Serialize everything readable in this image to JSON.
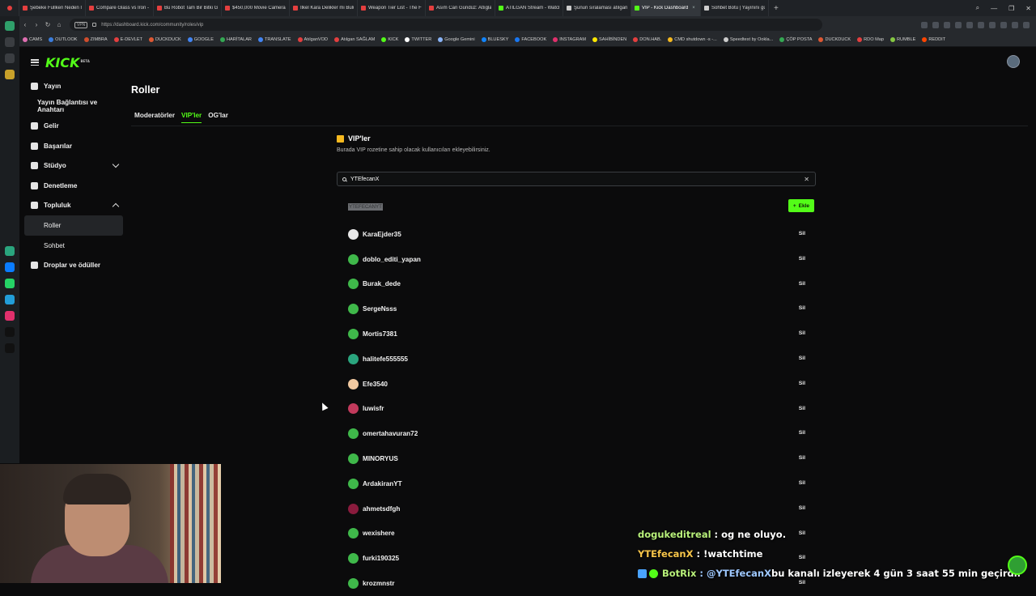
{
  "browser": {
    "tabs": [
      {
        "label": "Şebeke Fullken Neden İmi",
        "color": "#e43f3f",
        "active": false
      },
      {
        "label": "Compare Glass vs Iron - Y",
        "color": "#e43f3f",
        "active": false
      },
      {
        "label": "Bu Robot Tam Bir Bitki Gi",
        "color": "#e43f3f",
        "active": false
      },
      {
        "label": "$450,000 Movie Camera",
        "color": "#e43f3f",
        "active": false
      },
      {
        "label": "İlkel Kara Delikler mi Bulu",
        "color": "#e43f3f",
        "active": false
      },
      {
        "label": "Weapon Tier List - The Fo",
        "color": "#e43f3f",
        "active": false
      },
      {
        "label": "Asım Can Gündüz: Atlıgla",
        "color": "#e43f3f",
        "active": false
      },
      {
        "label": "ATILGAN Stream - Watch",
        "color": "#53fc18",
        "active": false
      },
      {
        "label": "Şunun sıralaması atılgan",
        "color": "#cccccc",
        "active": false
      },
      {
        "label": "VIP - Kick Dashboard",
        "color": "#53fc18",
        "active": true
      },
      {
        "label": "Sohbet Botu | Yayınını gü",
        "color": "#cccccc",
        "active": false
      }
    ],
    "url": "https://dashboard.kick.com/community/roles/vip",
    "vpn_label": "VPN",
    "bookmarks": [
      {
        "label": "CAMS",
        "color": "#e06fb1"
      },
      {
        "label": "OUTLOOK",
        "color": "#3b7ddd"
      },
      {
        "label": "ZIMBRA",
        "color": "#d04d2d"
      },
      {
        "label": "E-DEVLET",
        "color": "#e43f3f"
      },
      {
        "label": "DUCKDUCK",
        "color": "#de5833"
      },
      {
        "label": "GOOGLE",
        "color": "#4285f4"
      },
      {
        "label": "HARİTALAR",
        "color": "#34a853"
      },
      {
        "label": "TRANSLATE",
        "color": "#4285f4"
      },
      {
        "label": "AtılganVOD",
        "color": "#e43f3f"
      },
      {
        "label": "Atılgan SAĞLAM",
        "color": "#e43f3f"
      },
      {
        "label": "KICK",
        "color": "#53fc18"
      },
      {
        "label": "TWITTER",
        "color": "#ffffff"
      },
      {
        "label": "Google Gemini",
        "color": "#8ab4f8"
      },
      {
        "label": "BLUESKY",
        "color": "#1185fe"
      },
      {
        "label": "FACEBOOK",
        "color": "#1877f2"
      },
      {
        "label": "INSTAGRAM",
        "color": "#e1306c"
      },
      {
        "label": "SAHİBİNDEN",
        "color": "#ffe800"
      },
      {
        "label": "DON.HAB.",
        "color": "#e43f3f"
      },
      {
        "label": "CMD shutdown -s -...",
        "color": "#f6b91f"
      },
      {
        "label": "Speedtest by Ookla...",
        "color": "#cccccc"
      },
      {
        "label": "ÇÖP POSTA",
        "color": "#34a853"
      },
      {
        "label": "DUCKDUCK",
        "color": "#de5833"
      },
      {
        "label": "RDO Map",
        "color": "#e43f3f"
      },
      {
        "label": "RUMBLE",
        "color": "#85c742"
      },
      {
        "label": "REDDIT",
        "color": "#ff4500"
      }
    ]
  },
  "app": {
    "logo": "KICK",
    "logo_badge": "BETA",
    "nav": [
      {
        "label": "Yayın",
        "type": "main"
      },
      {
        "label": "Yayın Bağlantısı ve Anahtarı",
        "type": "indent"
      },
      {
        "label": "Gelir",
        "type": "main"
      },
      {
        "label": "Başarılar",
        "type": "main"
      },
      {
        "label": "Stüdyo",
        "type": "main"
      },
      {
        "label": "Denetleme",
        "type": "main"
      },
      {
        "label": "Topluluk",
        "type": "main"
      },
      {
        "label": "Roller",
        "type": "sub"
      },
      {
        "label": "Sohbet",
        "type": "sub"
      },
      {
        "label": "Droplar ve ödüller",
        "type": "main"
      }
    ],
    "page_title": "Roller",
    "tabs": [
      {
        "label": "Moderatörler",
        "active": false
      },
      {
        "label": "VIP'ler",
        "active": true
      },
      {
        "label": "OG'lar",
        "active": false
      }
    ],
    "vip": {
      "heading": "VIP'ler",
      "description": "Burada VIP rozetine sahip olacak kullanıcıları ekleyebilirsiniz.",
      "search_value": "YTEfecanX",
      "search_result": "YTEFECANYT",
      "add_label": "Ekle",
      "remove_label": "Sil",
      "users": [
        {
          "name": "KaraEjder35",
          "avatar_color": "#e8e8e8"
        },
        {
          "name": "doblo_editi_yapan",
          "avatar_color": "#3fb84a"
        },
        {
          "name": "Burak_dede",
          "avatar_color": "#3fb84a"
        },
        {
          "name": "SergeNsss",
          "avatar_color": "#3fb84a"
        },
        {
          "name": "Mortis7381",
          "avatar_color": "#3fb84a"
        },
        {
          "name": "halitefe555555",
          "avatar_color": "#2aa57e"
        },
        {
          "name": "Efe3540",
          "avatar_color": "#f2c9a0"
        },
        {
          "name": "luwisfr",
          "avatar_color": "#c23a5c"
        },
        {
          "name": "omertahavuran72",
          "avatar_color": "#3fb84a"
        },
        {
          "name": "MINORYUS",
          "avatar_color": "#3fb84a"
        },
        {
          "name": "ArdakiranYT",
          "avatar_color": "#3fb84a"
        },
        {
          "name": "ahmetsdfgh",
          "avatar_color": "#8a1b3d"
        },
        {
          "name": "wexishere",
          "avatar_color": "#3fb84a"
        },
        {
          "name": "furki190325",
          "avatar_color": "#3fb84a"
        },
        {
          "name": "krozmnstr",
          "avatar_color": "#3fb84a"
        }
      ]
    }
  },
  "chat_overlay": [
    {
      "user": "dogukeditreal",
      "user_color": "#b8f07a",
      "message": ": og ne oluyo."
    },
    {
      "user": "YTEfecanX",
      "user_color": "#f8c64a",
      "message": ": !watchtime"
    },
    {
      "user": "BotRix",
      "user_color": "#b8f07a",
      "message": ": @YTEfecanX",
      "mention_color": "#9ec8ff",
      "message_tail": " bu kanalı izleyerek 4 gün 3 saat 55 min geçirdi."
    }
  ]
}
